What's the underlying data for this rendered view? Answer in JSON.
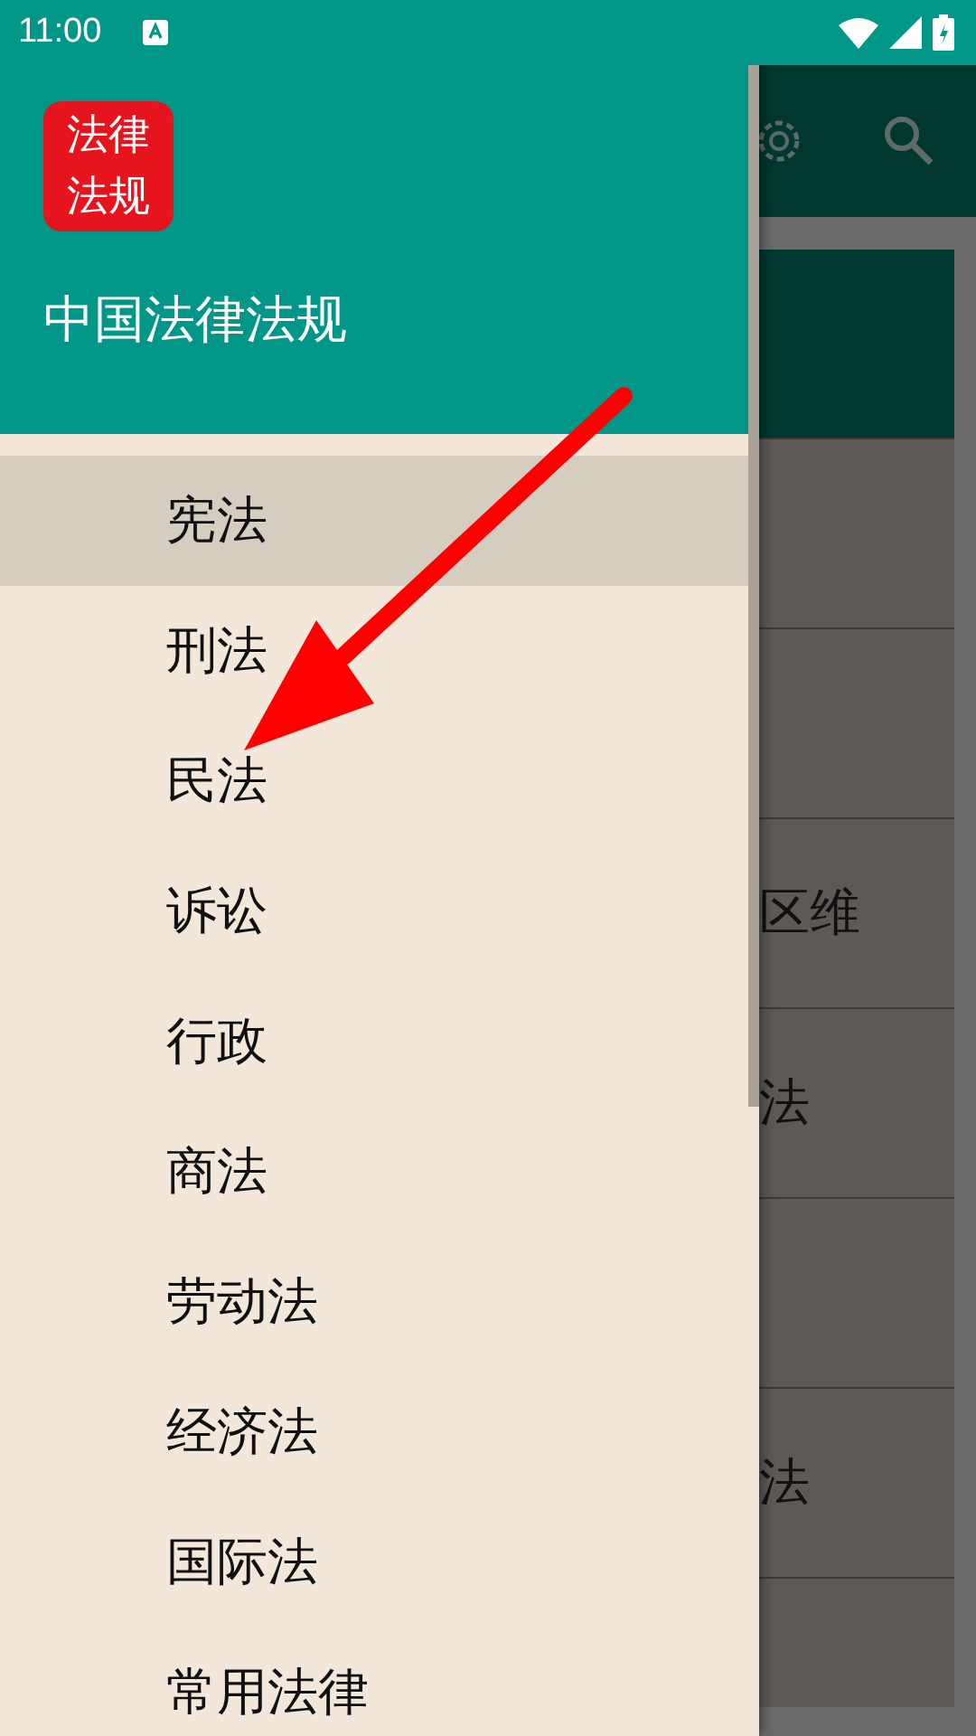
{
  "status_bar": {
    "time": "11:00"
  },
  "drawer": {
    "logo_lines": [
      "法律",
      "法规"
    ],
    "title": "中国法律法规",
    "items": [
      {
        "label": "宪法",
        "selected": true
      },
      {
        "label": "刑法",
        "selected": false
      },
      {
        "label": "民法",
        "selected": false
      },
      {
        "label": "诉讼",
        "selected": false
      },
      {
        "label": "行政",
        "selected": false
      },
      {
        "label": "商法",
        "selected": false
      },
      {
        "label": "劳动法",
        "selected": false
      },
      {
        "label": "经济法",
        "selected": false
      },
      {
        "label": "国际法",
        "selected": false
      },
      {
        "label": "常用法律",
        "selected": false
      }
    ]
  },
  "background_list": {
    "rows": [
      {
        "selected": true
      },
      {
        "selected": false
      },
      {
        "selected": false
      },
      {
        "selected": false,
        "text": "区维"
      },
      {
        "selected": false,
        "text": "法"
      },
      {
        "selected": false
      },
      {
        "selected": false,
        "text": "法"
      }
    ]
  }
}
